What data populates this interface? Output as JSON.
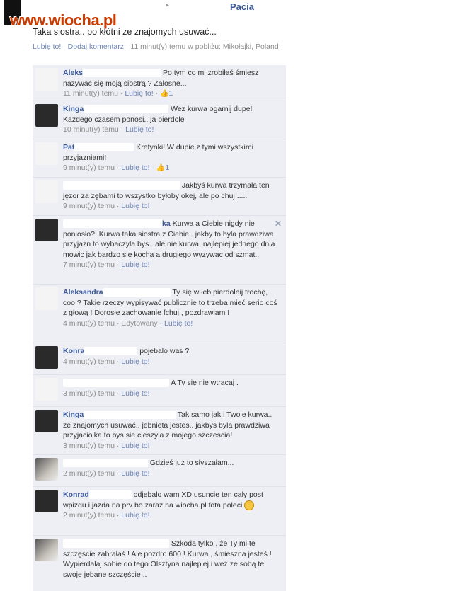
{
  "watermark": "www.wiocha.pl",
  "header": {
    "profile_name": "Pacia",
    "arrow": "▸"
  },
  "post": {
    "text": "Taka siostra.. po kłótni ze znajomych usuwać...",
    "meta": {
      "like": "Lubię to!",
      "comment": "Dodaj komentarz",
      "info": "11 minut(y) temu w pobliżu: Mikołajki, Poland",
      "sep": "·"
    }
  },
  "comments": [
    {
      "author": "Aleks",
      "text": "Po tym co mi zrobiłaś śmiesz nazywać się moją siostrą ? Żałosne...",
      "time": "11 minut(y) temu",
      "like": "Lubię to!",
      "likes": "1"
    },
    {
      "author": "Kinga",
      "text": "Wez kurwa ogarnij dupe! Kazdego czasem ponosi.. ja pierdole",
      "time": "10 minut(y) temu",
      "like": "Lubię to!"
    },
    {
      "author": "Pat",
      "text": "Kretynki! W dupie z tymi wszystkimi przyjazniami!",
      "time": "9 minut(y) temu",
      "like": "Lubię to!",
      "likes": "1"
    },
    {
      "author": "",
      "text": "Jakbyś kurwa trzymała ten jęzor za zębami to wszystko byłoby okej, ale po chuj .....",
      "time": "9 minut(y) temu",
      "like": "Lubię to!"
    },
    {
      "author": "ka",
      "text": "Kurwa a Ciebie nigdy nie poniosło?! Kurwa taka siostra z Ciebie.. jakby to byla prawdziwa przyjazn to wybaczyla bys.. ale nie kurwa, najlepiej jednego dnia mowic jak bardzo sie kocha a drugiego wyzywac od szmat..",
      "time": "7 minut(y) temu",
      "like": "Lubię to!",
      "close": "✕"
    },
    {
      "author": "Aleksandra",
      "text": "Ty się w łeb pierdolnij trochę, coo ? Takie rzeczy wypisywać publicznie to trzeba mieć serio coś z głową ! Dorosłe zachowanie fchuj , pozdrawiam !",
      "time": "4 minut(y) temu",
      "edited": "Edytowany",
      "like": "Lubię to!"
    },
    {
      "author": "Konra",
      "text": "pojebalo was ?",
      "time": "4 minut(y) temu",
      "like": "Lubię to!"
    },
    {
      "author": "",
      "text": "A Ty się nie wtrącaj .",
      "time": "3 minut(y) temu",
      "like": "Lubię to!"
    },
    {
      "author": "Kinga",
      "text": "Tak samo jak i Twoje kurwa.. ze znajomych usuwać.. jebnieta jestes.. jakbys byla prawdziwa przyjaciolka to bys sie cieszyla z mojego szczescia!",
      "time": "3 minut(y) temu",
      "like": "Lubię to!"
    },
    {
      "author": "",
      "text": "Gdzieś już to słyszałam...",
      "time": "2 minut(y) temu",
      "like": "Lubię to!"
    },
    {
      "author": "Konrad",
      "text": "odjebalo wam XD usuncie ten caly post wpizdu i jazda na prv bo zaraz na wiocha.pl fota poleci",
      "time": "2 minut(y) temu",
      "like": "Lubię to!"
    },
    {
      "author": "",
      "text": "Szkoda tylko , że Ty mi te szczęście zabrałaś ! Ale pozdro 600 ! Kurwa , śmieszna jesteś ! Wypierdalaj sobie do tego Olsztyna najlepiej i weź ze sobą te swoje jebane szczęście ..",
      "time": "",
      "like": ""
    }
  ]
}
